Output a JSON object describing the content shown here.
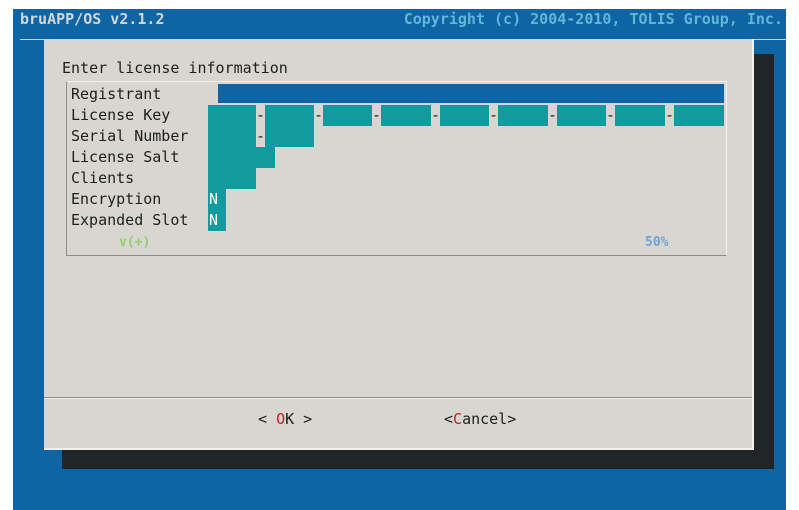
{
  "header": {
    "app_title": "bruAPP/OS v2.1.2",
    "copyright": "Copyright (c) 2004-2010, TOLIS Group, Inc."
  },
  "dialog": {
    "title": "Enter license information",
    "fields": [
      {
        "label": "Registrant",
        "value": ""
      },
      {
        "label": "License Key",
        "value": ""
      },
      {
        "label": "Serial Number",
        "value": ""
      },
      {
        "label": "License Salt",
        "value": ""
      },
      {
        "label": "Clients",
        "value": ""
      },
      {
        "label": "Encryption",
        "value": "N"
      },
      {
        "label": "Expanded Slot",
        "value": "N"
      }
    ],
    "separator": "-",
    "more_indicator": "v(+)",
    "scroll_percent": "50%",
    "buttons": {
      "ok_left": "< ",
      "ok_hot": "O",
      "ok_rest": "K",
      "ok_right": " >",
      "cancel_left": "<",
      "cancel_hot": "C",
      "cancel_rest": "ancel",
      "cancel_right": ">"
    }
  },
  "colors": {
    "screen_bg": "#0f64a3",
    "dialog_bg": "#d8d6d0",
    "field_bg": "#119b9f",
    "selected_field_bg": "#0e64a4",
    "hotkey": "#c62020"
  }
}
